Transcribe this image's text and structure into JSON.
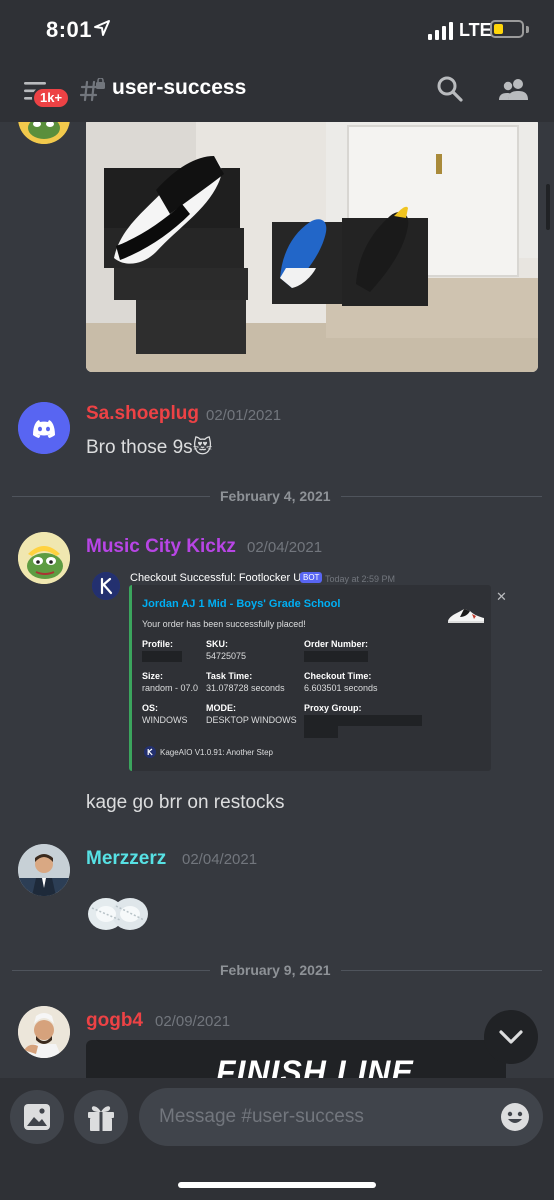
{
  "status_bar": {
    "time": "8:01",
    "network": "LTE",
    "battery_level": 0.35
  },
  "header": {
    "unread_badge": "1k+",
    "channel_name": "user-success"
  },
  "messages": [
    {
      "user": "Sa.shoeplug",
      "user_color": "#ed4245",
      "time": "02/01/2021",
      "text": "Bro those 9s",
      "emoji": "😻"
    },
    {
      "user": "Music City Kickz",
      "user_color": "#b845e5",
      "time": "02/04/2021",
      "text": "kage go brr on restocks"
    },
    {
      "user": "Merzzerz",
      "user_color": "#57e1e4",
      "time": "02/04/2021"
    },
    {
      "user": "gogb4",
      "user_color": "#ed4245",
      "time": "02/09/2021"
    }
  ],
  "dividers": [
    "February 4, 2021",
    "February 9, 2021"
  ],
  "embed": {
    "author": "Checkout Successful: Footlocker US",
    "bot_tag": "BOT",
    "author_time": "Today at 2:59 PM",
    "title": "Jordan AJ 1 Mid - Boys' Grade School",
    "description": "Your order has been successfully placed!",
    "fields": {
      "profile_label": "Profile:",
      "sku_label": "SKU:",
      "sku_value": "54725075",
      "order_label": "Order Number:",
      "size_label": "Size:",
      "size_value": "random - 07.0",
      "task_label": "Task Time:",
      "task_value": "31.078728 seconds",
      "checkout_label": "Checkout Time:",
      "checkout_value": "6.603501 seconds",
      "os_label": "OS:",
      "os_value": "WINDOWS",
      "mode_label": "MODE:",
      "mode_value": "DESKTOP WINDOWS",
      "proxy_label": "Proxy Group:"
    },
    "footer": "KageAIO V1.0.91: Another Step",
    "close": "✕"
  },
  "finish_line_logo": "FINISH LINE",
  "composer": {
    "placeholder": "Message #user-success"
  }
}
